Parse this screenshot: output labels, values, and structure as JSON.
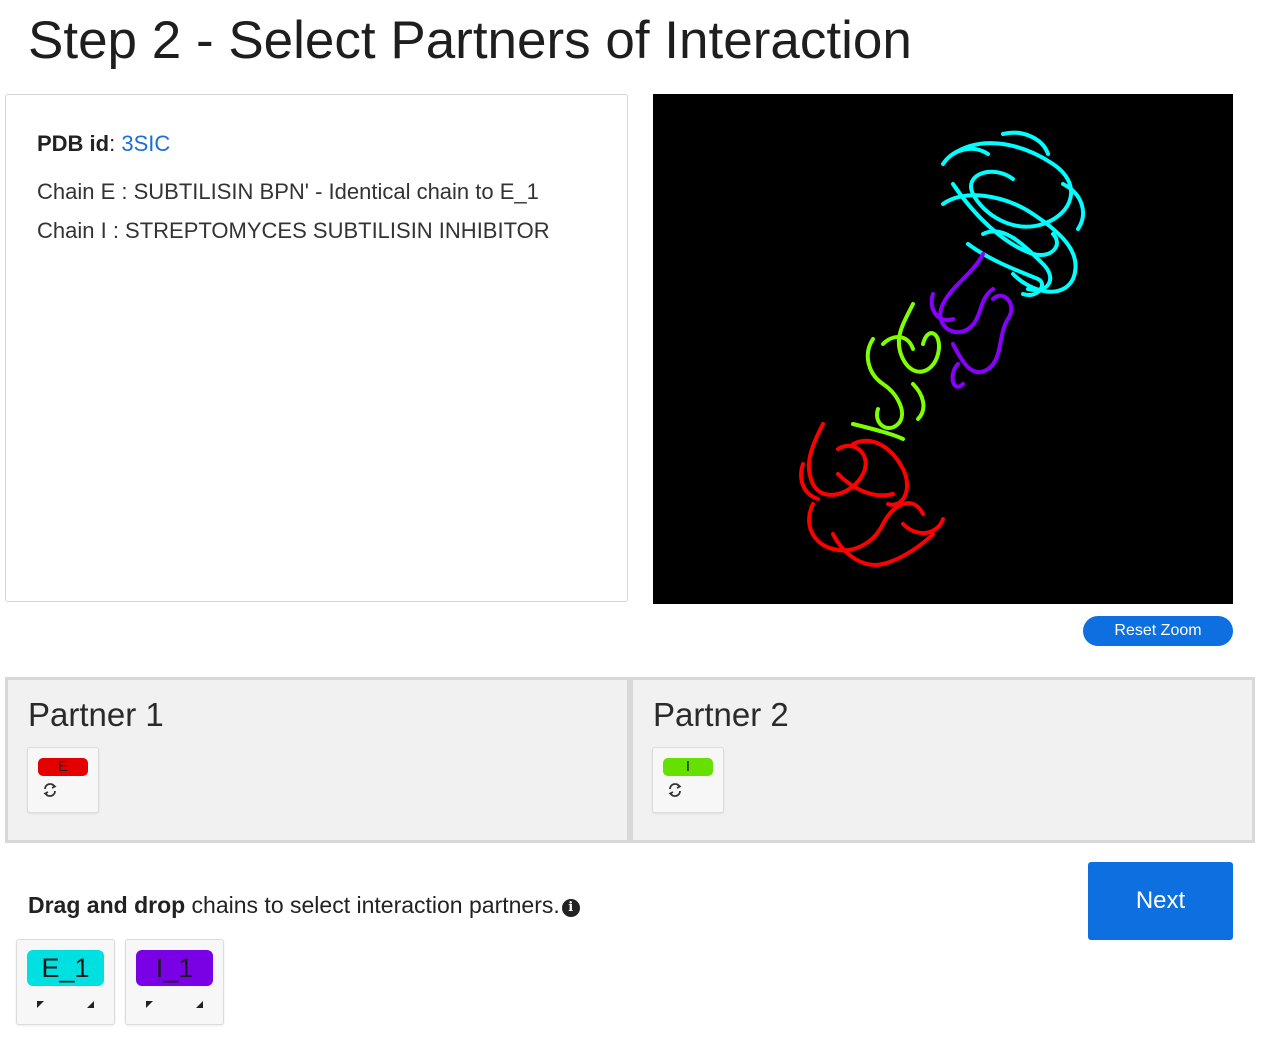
{
  "page": {
    "title": "Step 2 - Select Partners of Interaction"
  },
  "info": {
    "pdb_label": "PDB id",
    "pdb_id": "3SIC",
    "chains": [
      "Chain E : SUBTILISIN BPN' - Identical chain to E_1",
      "Chain I : STREPTOMYCES SUBTILISIN INHIBITOR"
    ]
  },
  "viewer": {
    "reset_zoom_label": "Reset Zoom",
    "chain_colors": {
      "E": "#ff0000",
      "I": "#7fff00",
      "E_1": "#00ffff",
      "I_1": "#8a00ff"
    }
  },
  "partners": [
    {
      "title": "Partner 1",
      "chain": {
        "label": "E",
        "color": "#e50000",
        "icon": "sync-icon"
      }
    },
    {
      "title": "Partner 2",
      "chain": {
        "label": "I",
        "color": "#66e000",
        "icon": "sync-icon"
      }
    }
  ],
  "instructions": {
    "bold": "Drag and drop",
    "rest": " chains to select interaction partners.",
    "icon": "info-icon"
  },
  "next_label": "Next",
  "available_chains": [
    {
      "label": "E_1",
      "color": "#00e0e0"
    },
    {
      "label": "I_1",
      "color": "#7a00e6"
    }
  ]
}
